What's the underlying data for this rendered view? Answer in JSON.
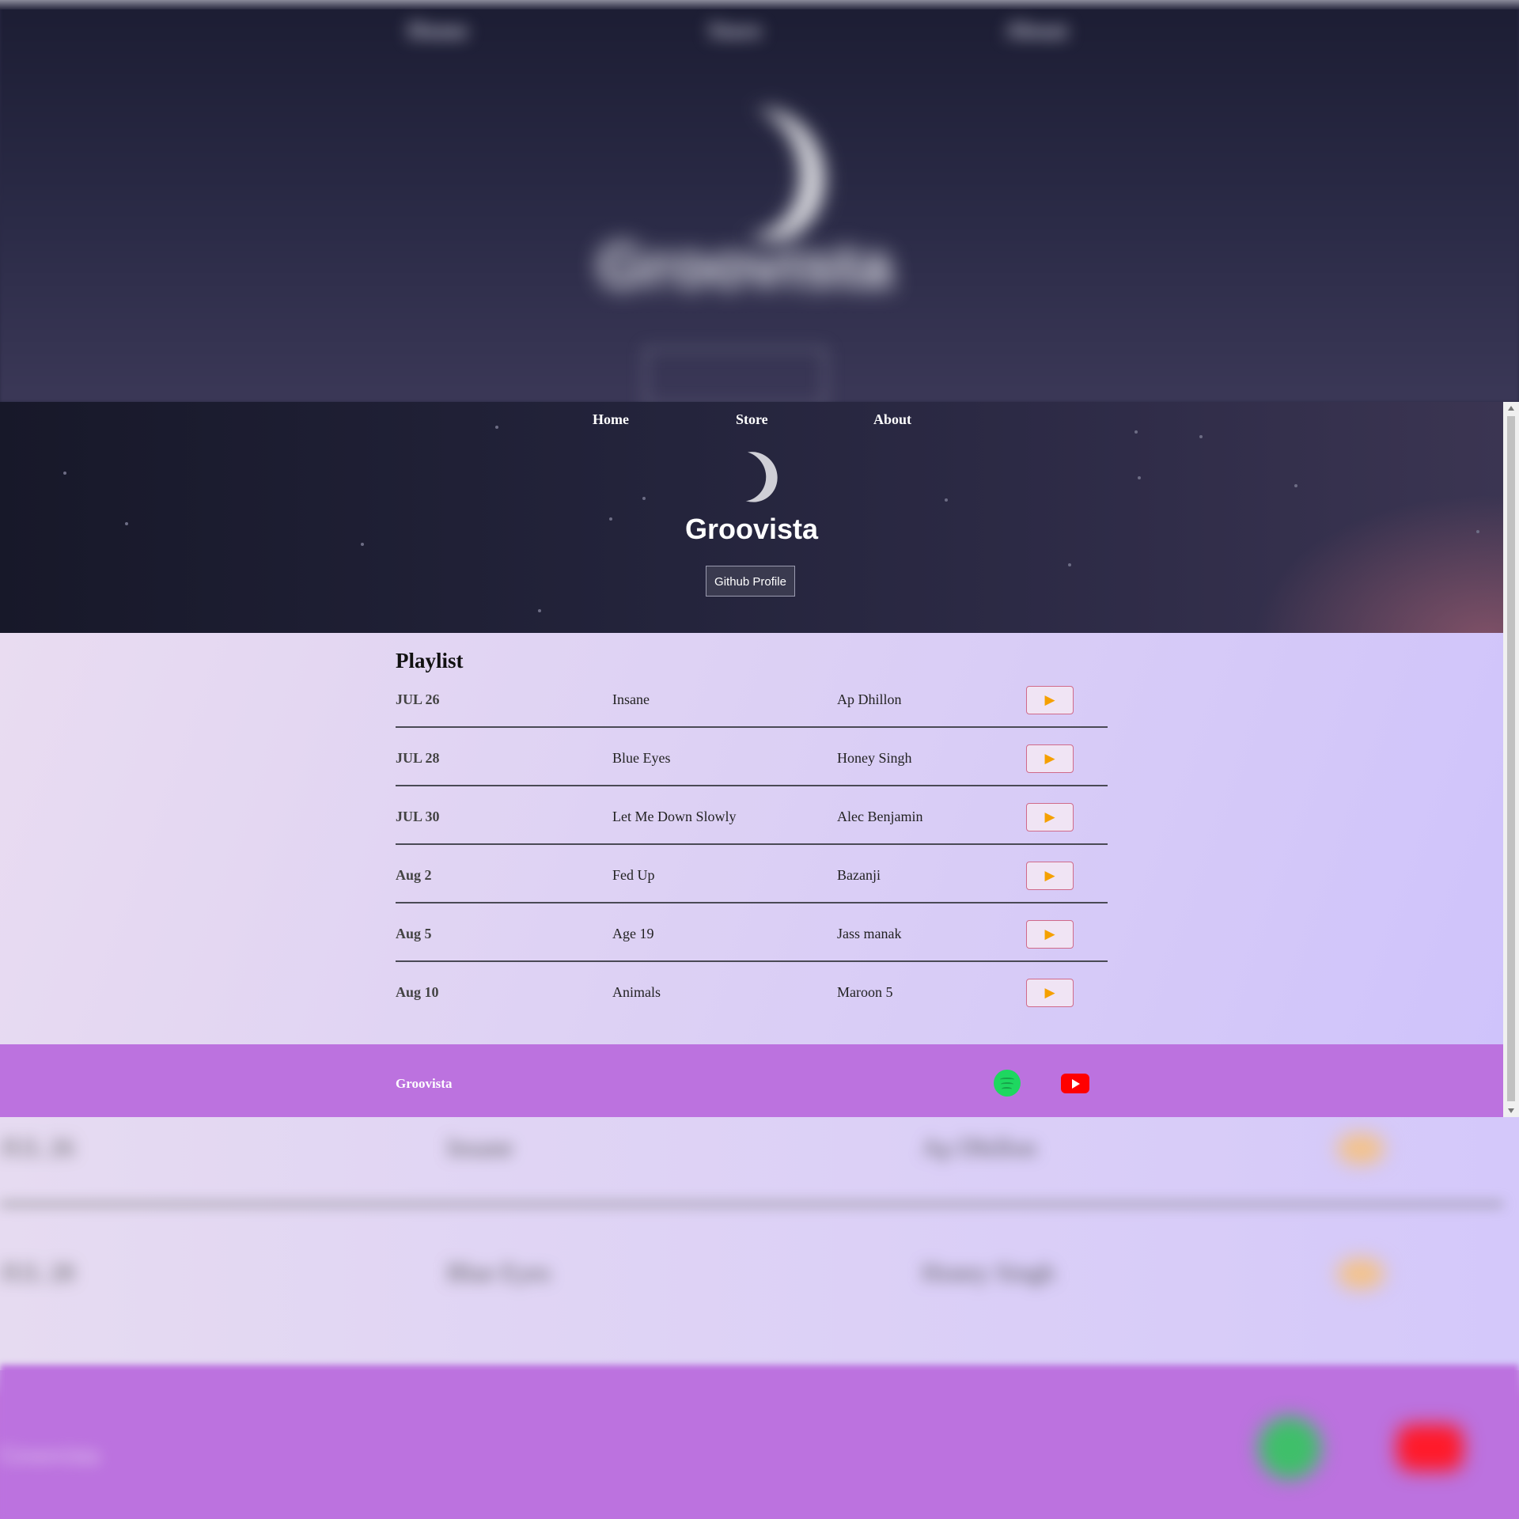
{
  "nav": {
    "links": [
      {
        "label": "Home"
      },
      {
        "label": "Store"
      },
      {
        "label": "About"
      }
    ]
  },
  "hero": {
    "title": "Groovista",
    "icon": "crescent-moon-icon",
    "github_button": "Github Profile"
  },
  "playlist": {
    "title": "Playlist",
    "rows": [
      {
        "date": "JUL 26",
        "song": "Insane",
        "artist": "Ap Dhillon",
        "action_icon": "play-icon"
      },
      {
        "date": "JUL 28",
        "song": "Blue Eyes",
        "artist": "Honey Singh",
        "action_icon": "play-icon"
      },
      {
        "date": "JUL 30",
        "song": "Let Me Down Slowly",
        "artist": "Alec Benjamin",
        "action_icon": "play-icon"
      },
      {
        "date": "Aug 2",
        "song": "Fed Up",
        "artist": "Bazanji",
        "action_icon": "play-icon"
      },
      {
        "date": "Aug 5",
        "song": "Age 19",
        "artist": "Jass manak",
        "action_icon": "play-icon"
      },
      {
        "date": "Aug 10",
        "song": "Animals",
        "artist": "Maroon 5",
        "action_icon": "play-icon"
      }
    ],
    "play_glyph": "▶"
  },
  "footer": {
    "brand": "Groovista",
    "icons": [
      "spotify-icon",
      "youtube-icon"
    ]
  },
  "colors": {
    "hero_bg": "#24243c",
    "content_bg": "#ddd1f4",
    "footer_bg": "#bc72df",
    "play_accent": "#f5a000",
    "play_border": "#d06a8a",
    "spotify_green": "#1ed760",
    "youtube_red": "#ff0000"
  }
}
